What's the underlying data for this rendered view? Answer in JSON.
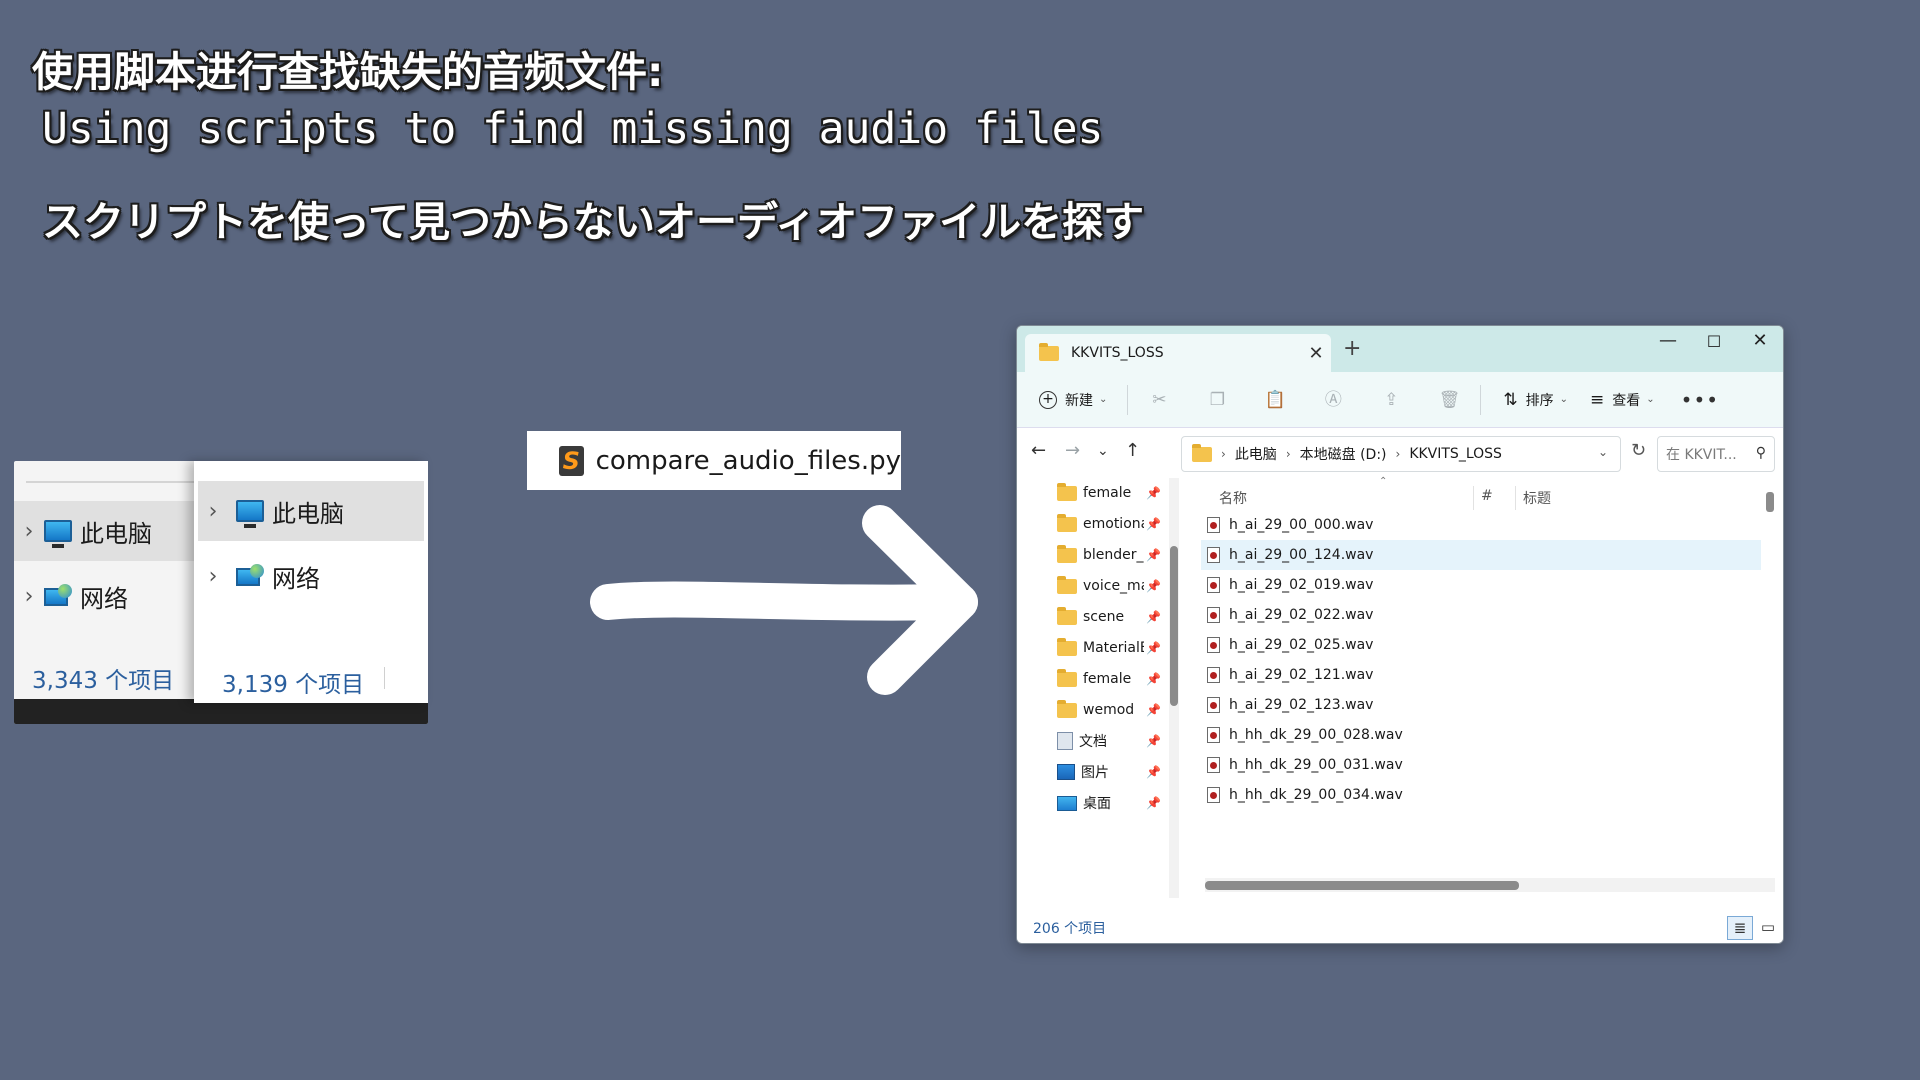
{
  "captions": {
    "zh": "使用脚本进行查找缺失的音频文件:",
    "en": "Using scripts to find missing audio files",
    "ja": "スクリプトを使って見つからないオーディオファイルを探す"
  },
  "panel_a": {
    "items": [
      {
        "label": "此电脑",
        "icon": "pc-icon"
      },
      {
        "label": "网络",
        "icon": "network-icon"
      }
    ],
    "count": "3,343 个项目"
  },
  "panel_b": {
    "items": [
      {
        "label": "此电脑",
        "icon": "pc-icon"
      },
      {
        "label": "网络",
        "icon": "network-icon"
      }
    ],
    "count": "3,139 个项目"
  },
  "script": {
    "icon": "sublime-text-icon",
    "name": "compare_audio_files.py"
  },
  "explorer": {
    "tab_title": "KKVITS_LOSS",
    "toolbar": {
      "new_label": "新建",
      "sort_label": "排序",
      "view_label": "查看"
    },
    "breadcrumb": [
      "此电脑",
      "本地磁盘 (D:)",
      "KKVITS_LOSS"
    ],
    "search_placeholder": "在 KKVIT...",
    "sidebar": [
      {
        "label": "female",
        "icon": "folder-icon"
      },
      {
        "label": "emotional",
        "icon": "folder-icon"
      },
      {
        "label": "blender_p",
        "icon": "folder-icon"
      },
      {
        "label": "voice_ma",
        "icon": "folder-icon"
      },
      {
        "label": "scene",
        "icon": "folder-icon"
      },
      {
        "label": "MaterialE",
        "icon": "folder-icon"
      },
      {
        "label": "female",
        "icon": "folder-icon"
      },
      {
        "label": "wemod",
        "icon": "folder-icon"
      },
      {
        "label": "文档",
        "icon": "documents-icon"
      },
      {
        "label": "图片",
        "icon": "pictures-icon"
      },
      {
        "label": "桌面",
        "icon": "desktop-icon"
      }
    ],
    "columns": [
      "名称",
      "#",
      "标题"
    ],
    "files": [
      "h_ai_29_00_000.wav",
      "h_ai_29_00_124.wav",
      "h_ai_29_02_019.wav",
      "h_ai_29_02_022.wav",
      "h_ai_29_02_025.wav",
      "h_ai_29_02_121.wav",
      "h_ai_29_02_123.wav",
      "h_hh_dk_29_00_028.wav",
      "h_hh_dk_29_00_031.wav",
      "h_hh_dk_29_00_034.wav"
    ],
    "selected_file_index": 1,
    "status": "206 个项目"
  },
  "colors": {
    "background": "#5a667f",
    "titlebar": "#cde9e8",
    "selection": "#e5f3fb",
    "count_text": "#2b5f9e"
  }
}
